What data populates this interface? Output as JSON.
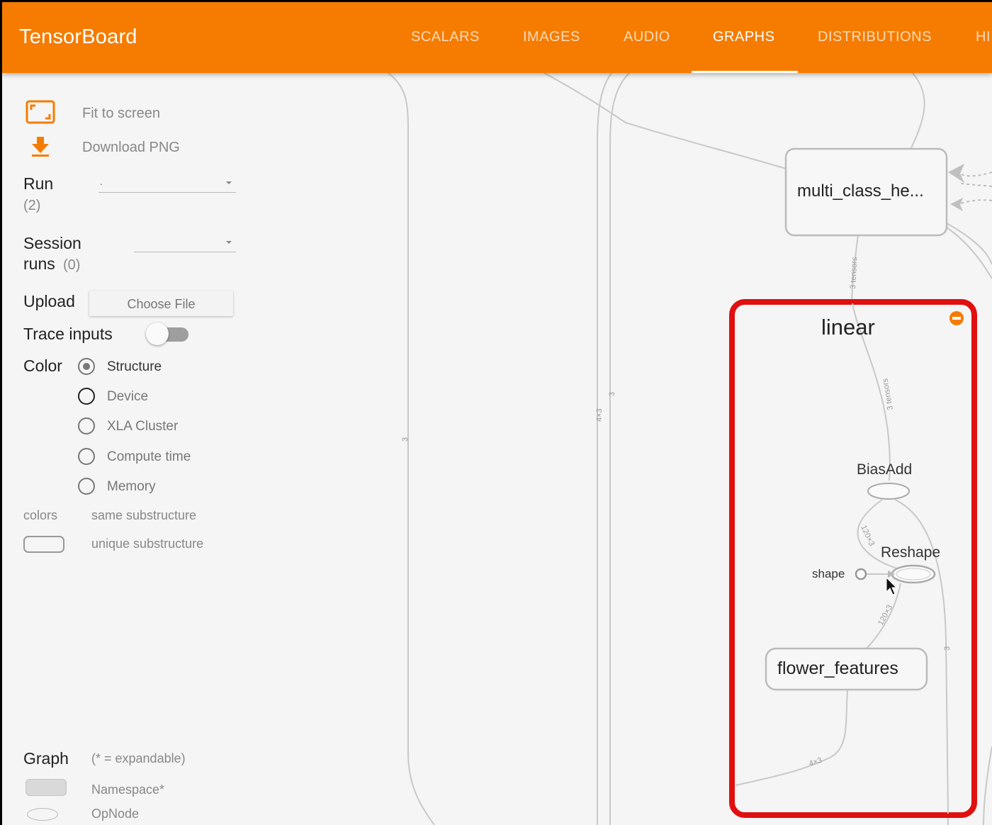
{
  "app": {
    "title": "TensorBoard"
  },
  "nav": {
    "tabs": [
      {
        "label": "SCALARS"
      },
      {
        "label": "IMAGES"
      },
      {
        "label": "AUDIO"
      },
      {
        "label": "GRAPHS",
        "active": true
      },
      {
        "label": "DISTRIBUTIONS"
      },
      {
        "label": "HI"
      }
    ]
  },
  "sidebar": {
    "fit_to_screen": "Fit to screen",
    "download_png": "Download PNG",
    "run": {
      "label": "Run",
      "count": "(2)",
      "value": "."
    },
    "session_runs": {
      "label_line1": "Session",
      "label_line2": "runs",
      "count": "(0)"
    },
    "upload": {
      "label": "Upload",
      "button": "Choose File"
    },
    "trace_inputs": {
      "label": "Trace inputs",
      "enabled": false
    },
    "color": {
      "label": "Color",
      "options": [
        {
          "label": "Structure",
          "selected": true
        },
        {
          "label": "Device",
          "selected": false
        },
        {
          "label": "XLA Cluster",
          "selected": false
        },
        {
          "label": "Compute time",
          "selected": false
        },
        {
          "label": "Memory",
          "selected": false
        }
      ]
    },
    "colors_legend": {
      "label": "colors",
      "same": "same substructure",
      "unique": "unique substructure"
    },
    "graph_legend": {
      "label": "Graph",
      "note": "(* = expandable)",
      "namespace": "Namespace*",
      "opnode": "OpNode"
    }
  },
  "graph": {
    "nodes": {
      "multi_class": "multi_class_he...",
      "linear": "linear",
      "biasadd": "BiasAdd",
      "reshape": "Reshape",
      "shape": "shape",
      "flower_features": "flower_features"
    },
    "edge_labels": {
      "e1": "3",
      "e2": "4×3",
      "e3": "3",
      "e4": "3 tensors",
      "e5": "3 tensors",
      "e6": "120×3",
      "e7": "120×3",
      "e8": "3",
      "e9": "4×3"
    },
    "highlight_color": "#e01010",
    "accent_color": "#f57c00"
  }
}
